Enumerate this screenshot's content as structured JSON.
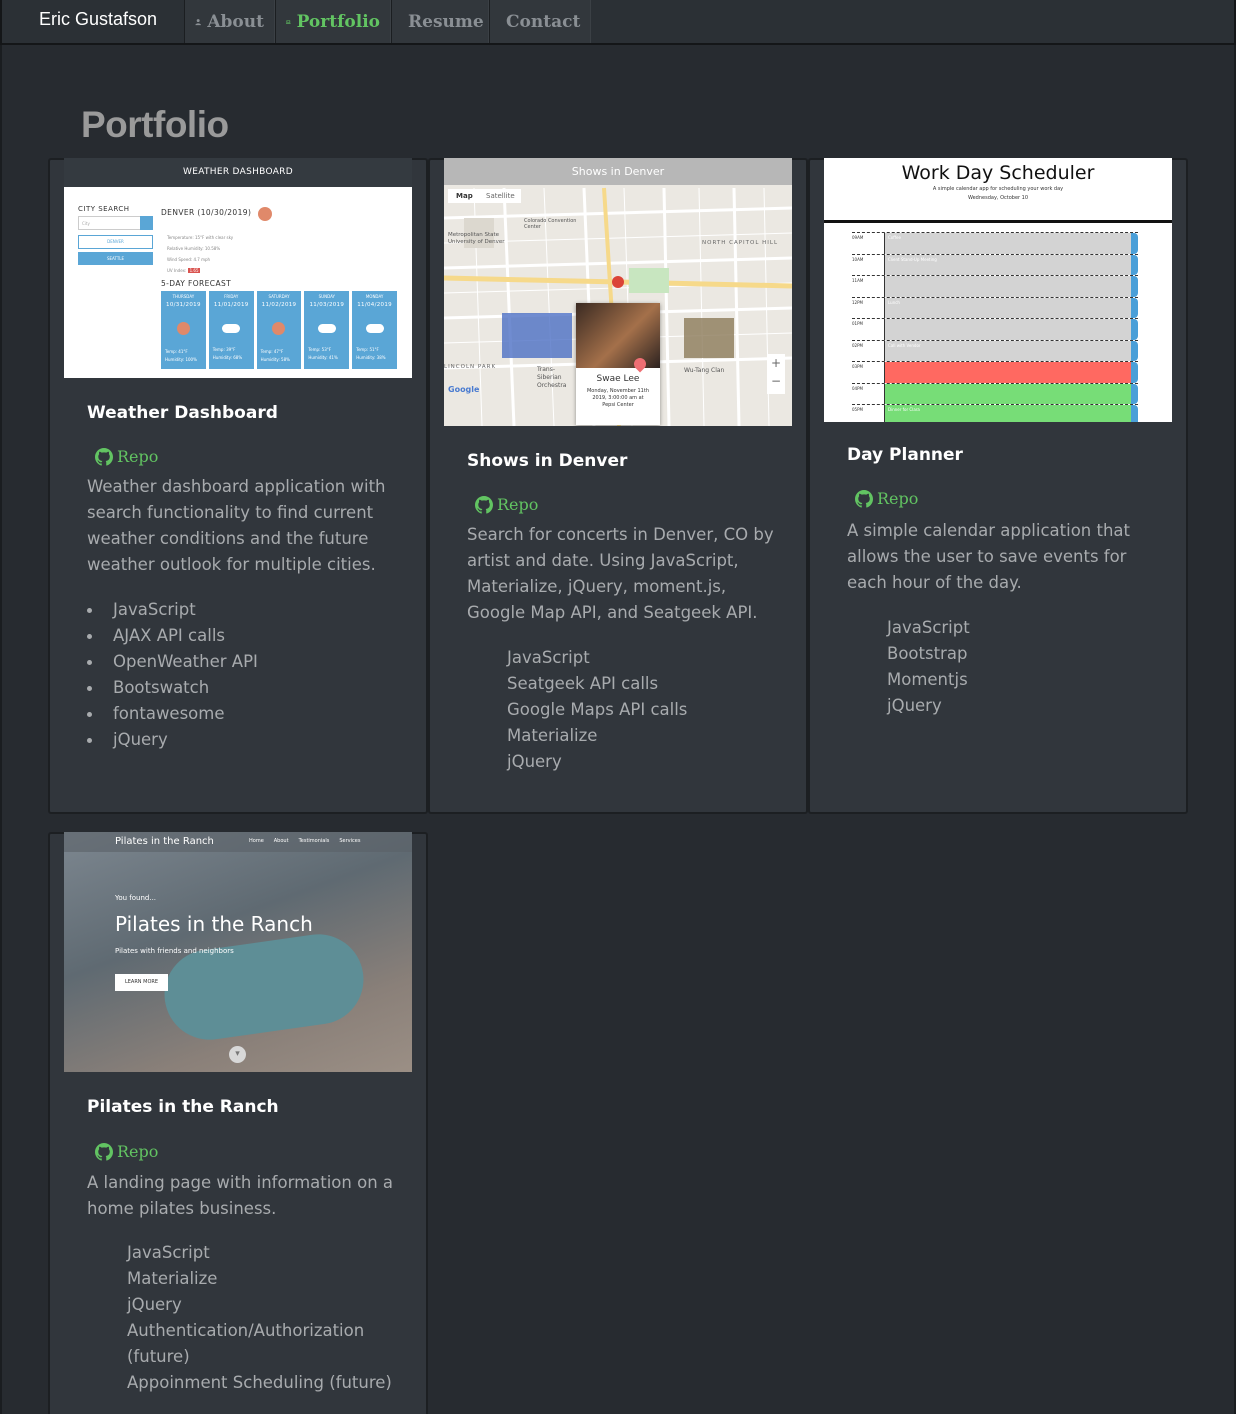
{
  "navbar": {
    "brand": "Eric Gustafson",
    "items": [
      {
        "label": "About",
        "icon": "user-icon",
        "active": false
      },
      {
        "label": "Portfolio",
        "icon": "laptop-icon",
        "active": true
      },
      {
        "label": "Resume",
        "icon": "file-icon",
        "active": false
      },
      {
        "label": "Contact",
        "icon": "envelope-icon",
        "active": false
      }
    ]
  },
  "page": {
    "title": "Portfolio"
  },
  "colors": {
    "background": "#272b30",
    "card": "#31363c",
    "accent_green": "#62c462"
  },
  "projects": [
    {
      "title": "Weather Dashboard",
      "repo_label": "Repo",
      "description": "Weather dashboard application with search functionality to find current weather conditions and the future weather outlook for multiple cities.",
      "tech": [
        "JavaScript",
        "AJAX API calls",
        "OpenWeather API",
        "Bootswatch",
        "fontawesome",
        "jQuery"
      ],
      "thumb": {
        "header": "WEATHER DASHBOARD",
        "search_label": "CITY SEARCH",
        "search_placeholder": "City",
        "recent_city": "DENVER",
        "search_city_2": "SEATTLE",
        "city_heading": "DENVER (10/30/2019)",
        "stats": [
          "Temperature: 15°F with clear sky",
          "Relative Humidity: 10.58%",
          "Wind Speed: 4.7 mph",
          "UV Index:"
        ],
        "uv_value": "1.65",
        "forecast_title": "5-DAY FORECAST",
        "forecast": [
          {
            "day": "THURSDAY",
            "date": "10/31/2019",
            "icon": "sun-icon",
            "temp": "Temp: 41°F",
            "humidity": "Humidity: 100%"
          },
          {
            "day": "FRIDAY",
            "date": "11/01/2019",
            "icon": "cloud-icon",
            "temp": "Temp: 39°F",
            "humidity": "Humidity: 68%"
          },
          {
            "day": "SATURDAY",
            "date": "11/02/2019",
            "icon": "sun-icon",
            "temp": "Temp: 47°F",
            "humidity": "Humidity: 58%"
          },
          {
            "day": "SUNDAY",
            "date": "11/03/2019",
            "icon": "cloud-icon",
            "temp": "Temp: 53°F",
            "humidity": "Humidity: 41%"
          },
          {
            "day": "MONDAY",
            "date": "11/04/2019",
            "icon": "cloud-sun-icon",
            "temp": "Temp: 51°F",
            "humidity": "Humidity: 38%"
          }
        ]
      }
    },
    {
      "title": "Shows in Denver",
      "repo_label": "Repo",
      "description": "Search for concerts in Denver, CO by artist and date. Using JavaScript, Materialize, jQuery, moment.js, Google Map API, and Seatgeek API.",
      "tech": [
        "JavaScript",
        "Seatgeek API calls",
        "Google Maps API calls",
        "Materialize",
        "jQuery"
      ],
      "thumb": {
        "header": "Shows in Denver",
        "map_tab": "Map",
        "satellite_tab": "Satellite",
        "map_labels": [
          "Metropolitan State University of Denver",
          "NORTH CAPITOL HILL",
          "LINCOLN PARK",
          "Trans-Siberian Orchestra",
          "Wu-Tang Clan",
          "Colorado Convention Center"
        ],
        "popup_artist": "Swae Lee",
        "popup_date": "Monday, November 11th 2019, 3:00:00 am at",
        "popup_venue": "Pepsi Center",
        "google_logo": "Google"
      }
    },
    {
      "title": "Day Planner",
      "repo_label": "Repo",
      "description": "A simple calendar application that allows the user to save events for each hour of the day.",
      "tech": [
        "JavaScript",
        "Bootstrap",
        "Momentjs",
        "jQuery"
      ],
      "thumb": {
        "header": "Work Day Scheduler",
        "subheader": "A simple calendar app for scheduling your work day",
        "date": "Wednesday, October 10",
        "hours": [
          "09AM",
          "10AM",
          "11AM",
          "12PM",
          "01PM",
          "02PM",
          "03PM",
          "04PM",
          "05PM"
        ],
        "notes": [
          "Coffee",
          "Client Stand-Up Meeting",
          "",
          "Lunch",
          "",
          "Call with Vendor",
          "",
          "",
          "Dinner for Clara"
        ]
      }
    },
    {
      "title": "Pilates in the Ranch",
      "repo_label": "Repo",
      "description": "A landing page with information on a home pilates business.",
      "tech": [
        "JavaScript",
        "Materialize",
        "jQuery",
        "Authentication/Authorization (future)",
        "Appoinment Scheduling (future)"
      ],
      "thumb": {
        "site_name": "Pilates in the Ranch",
        "nav": [
          "Home",
          "About",
          "Testimonials",
          "Services"
        ],
        "kicker": "You found...",
        "headline": "Pilates in the Ranch",
        "tagline": "Pilates with friends and neighbors",
        "button": "LEARN MORE"
      }
    }
  ]
}
